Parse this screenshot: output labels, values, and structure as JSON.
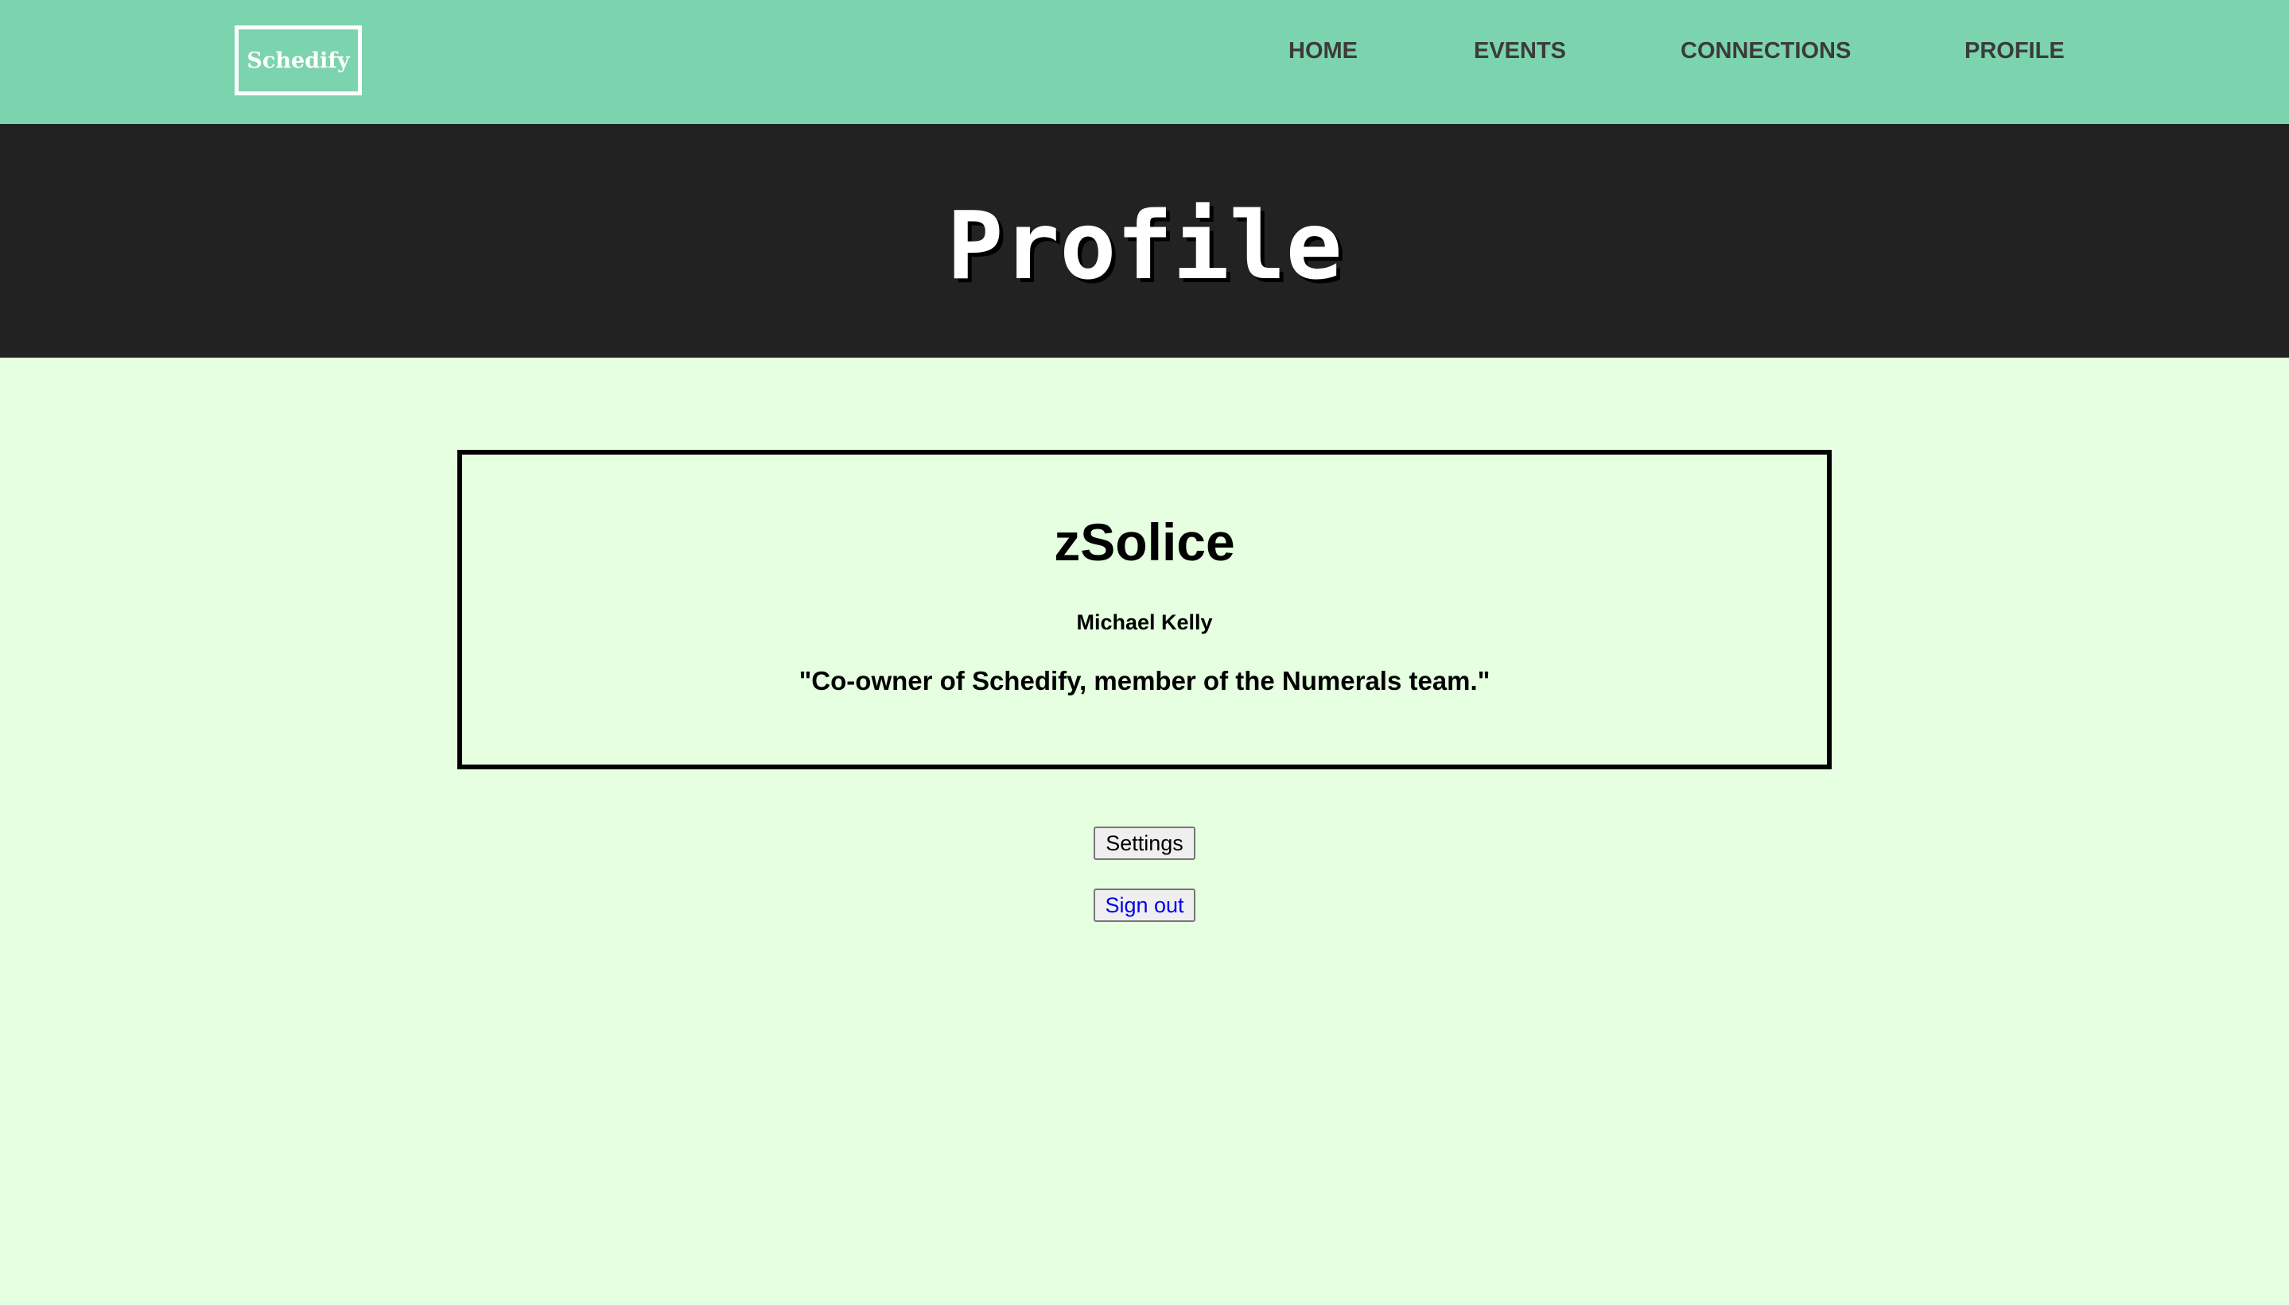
{
  "navbar": {
    "logo_text": "Schedify",
    "items": [
      {
        "label": "HOME"
      },
      {
        "label": "EVENTS"
      },
      {
        "label": "CONNECTIONS"
      },
      {
        "label": "PROFILE"
      }
    ]
  },
  "hero": {
    "title": "Profile"
  },
  "profile": {
    "username": "zSolice",
    "full_name": "Michael Kelly",
    "bio": "\"Co-owner of Schedify, member of the Numerals team.\""
  },
  "actions": {
    "settings_label": "Settings",
    "sign_out_label": "Sign out"
  },
  "colors": {
    "navbar_bg": "#7bd4ad",
    "hero_bg": "#222222",
    "page_bg": "#e5ffe0",
    "link_blue": "#0000ee"
  }
}
